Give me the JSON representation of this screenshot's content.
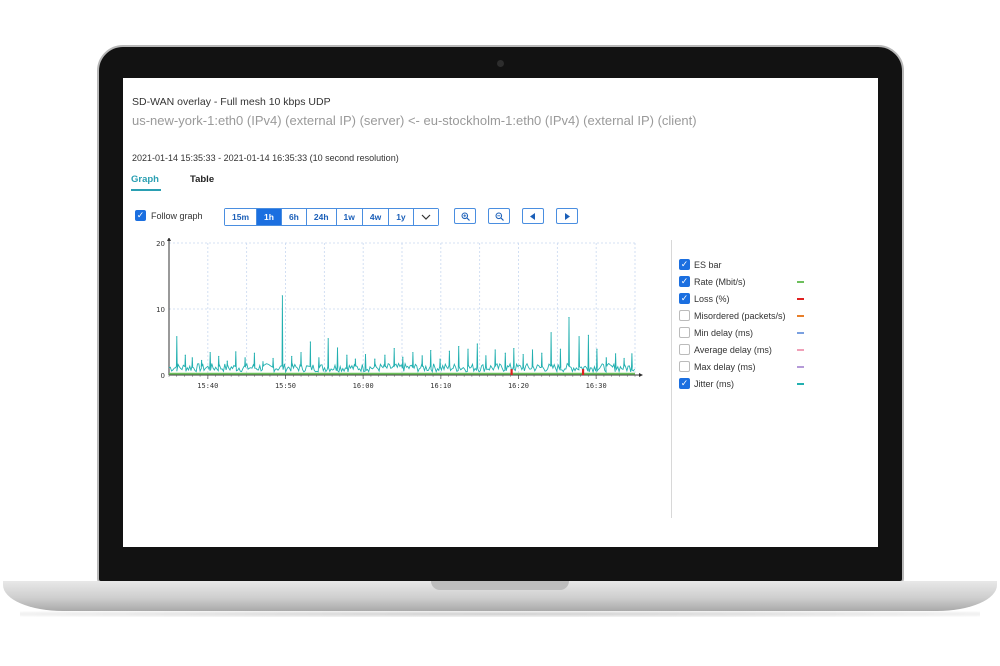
{
  "header": {
    "title": "SD-WAN overlay - Full mesh 10 kbps UDP",
    "subtitle": "us-new-york-1:eth0 (IPv4) (external IP) (server) <- eu-stockholm-1:eth0 (IPv4) (external IP) (client)",
    "time_range": "2021-01-14 15:35:33 - 2021-01-14 16:35:33 (10 second resolution)"
  },
  "tabs": [
    {
      "label": "Graph",
      "active": true
    },
    {
      "label": "Table",
      "active": false
    }
  ],
  "controls": {
    "follow_graph": {
      "label": "Follow graph",
      "checked": true
    },
    "ranges": [
      "15m",
      "1h",
      "6h",
      "24h",
      "1w",
      "4w",
      "1y"
    ],
    "selected_range": "1h",
    "icons": [
      "chevron-down-icon",
      "zoom-in-icon",
      "zoom-out-icon",
      "arrow-left-icon",
      "arrow-right-icon"
    ]
  },
  "legend": [
    {
      "label": "ES bar",
      "checked": true,
      "color": ""
    },
    {
      "label": "Rate (Mbit/s)",
      "checked": true,
      "color": "#6dbf5c"
    },
    {
      "label": "Loss (%)",
      "checked": true,
      "color": "#e02020"
    },
    {
      "label": "Misordered (packets/s)",
      "checked": false,
      "color": "#e87f2a"
    },
    {
      "label": "Min delay (ms)",
      "checked": false,
      "color": "#7aa0e0"
    },
    {
      "label": "Average delay (ms)",
      "checked": false,
      "color": "#f0a0b8"
    },
    {
      "label": "Max delay (ms)",
      "checked": false,
      "color": "#b59ad8"
    },
    {
      "label": "Jitter (ms)",
      "checked": true,
      "color": "#22b0b0"
    }
  ],
  "chart_data": {
    "type": "line",
    "x_ticks": [
      "15:40",
      "15:50",
      "16:00",
      "16:10",
      "16:20",
      "16:30"
    ],
    "y_ticks": [
      "0",
      "10",
      "20"
    ],
    "ylim": [
      0,
      20
    ],
    "xlim_minutes": [
      0,
      60
    ],
    "grid": true,
    "series": [
      {
        "name": "Jitter (ms)",
        "color": "#22b0b0",
        "spikes": [
          [
            1.0,
            5.8
          ],
          [
            2.1,
            3.0
          ],
          [
            3.0,
            2.6
          ],
          [
            4.2,
            2.2
          ],
          [
            5.3,
            3.4
          ],
          [
            6.4,
            2.8
          ],
          [
            7.5,
            2.1
          ],
          [
            8.6,
            3.5
          ],
          [
            9.8,
            2.6
          ],
          [
            11.0,
            3.3
          ],
          [
            12.1,
            2.0
          ],
          [
            13.4,
            2.5
          ],
          [
            14.6,
            12.0
          ],
          [
            15.8,
            2.8
          ],
          [
            17.0,
            3.4
          ],
          [
            18.2,
            5.0
          ],
          [
            19.3,
            2.6
          ],
          [
            20.5,
            5.5
          ],
          [
            21.7,
            4.1
          ],
          [
            22.9,
            3.0
          ],
          [
            24.0,
            2.4
          ],
          [
            25.3,
            3.1
          ],
          [
            26.5,
            2.4
          ],
          [
            27.8,
            3.0
          ],
          [
            29.0,
            4.0
          ],
          [
            30.1,
            2.7
          ],
          [
            31.4,
            3.4
          ],
          [
            32.6,
            2.9
          ],
          [
            33.7,
            3.7
          ],
          [
            34.9,
            2.4
          ],
          [
            36.1,
            3.6
          ],
          [
            37.3,
            4.3
          ],
          [
            38.5,
            3.9
          ],
          [
            39.7,
            4.7
          ],
          [
            40.8,
            2.9
          ],
          [
            42.0,
            3.8
          ],
          [
            43.3,
            3.3
          ],
          [
            44.4,
            4.0
          ],
          [
            45.6,
            3.1
          ],
          [
            46.8,
            3.8
          ],
          [
            48.0,
            3.3
          ],
          [
            49.2,
            6.4
          ],
          [
            50.4,
            3.9
          ],
          [
            51.5,
            8.7
          ],
          [
            52.8,
            5.8
          ],
          [
            54.0,
            6.0
          ],
          [
            55.1,
            3.9
          ],
          [
            56.3,
            2.6
          ],
          [
            57.5,
            3.2
          ],
          [
            58.6,
            2.5
          ],
          [
            59.6,
            3.2
          ]
        ],
        "baseline": 1.3
      },
      {
        "name": "Rate (Mbit/s)",
        "color": "#6dbf5c",
        "value": 0.2
      },
      {
        "name": "Loss (%)",
        "color": "#e02020",
        "spikes": [
          [
            44.1,
            0.9
          ],
          [
            53.3,
            0.9
          ]
        ]
      }
    ]
  }
}
